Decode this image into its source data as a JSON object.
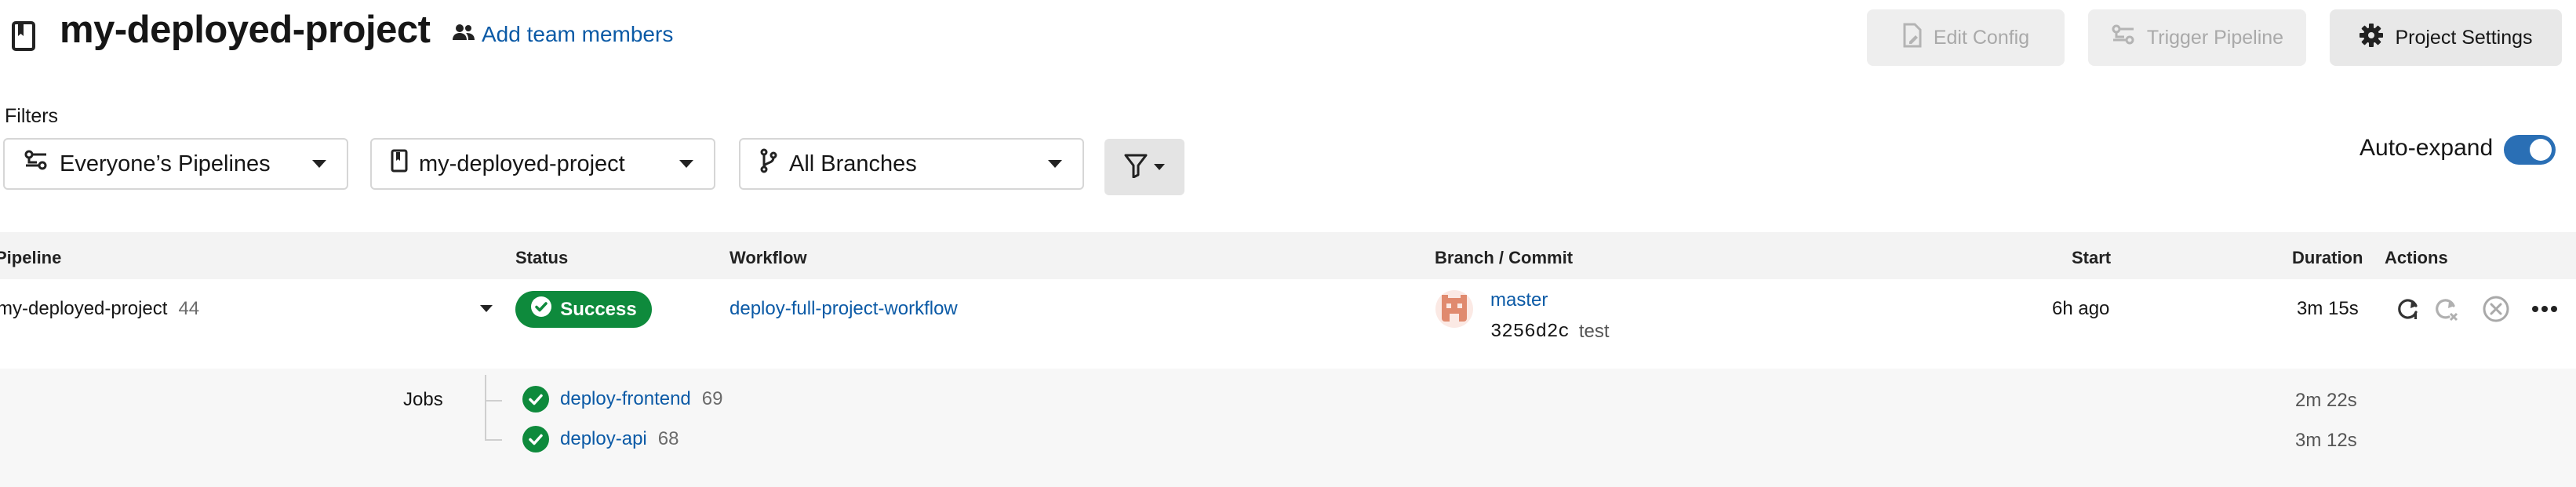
{
  "header": {
    "project_title": "my-deployed-project",
    "add_team_label": "Add team members",
    "edit_config_label": "Edit Config",
    "trigger_pipeline_label": "Trigger Pipeline",
    "project_settings_label": "Project Settings"
  },
  "filters": {
    "label": "Filters",
    "pipelines_dropdown": "Everyone’s Pipelines",
    "project_dropdown": "my-deployed-project",
    "branches_dropdown": "All Branches",
    "auto_expand_label": "Auto-expand",
    "auto_expand_on": true
  },
  "table": {
    "headers": {
      "pipeline": "Pipeline",
      "status": "Status",
      "workflow": "Workflow",
      "branch_commit": "Branch / Commit",
      "start": "Start",
      "duration": "Duration",
      "actions": "Actions"
    },
    "row": {
      "pipeline_name": "my-deployed-project",
      "pipeline_number": "44",
      "status": "Success",
      "workflow": "deploy-full-project-workflow",
      "branch": "master",
      "commit_hash": "3256d2c",
      "commit_message": "test",
      "start": "6h ago",
      "duration": "3m 15s"
    },
    "jobs_label": "Jobs",
    "jobs": [
      {
        "name": "deploy-frontend",
        "number": "69",
        "duration": "2m 22s"
      },
      {
        "name": "deploy-api",
        "number": "68",
        "duration": "3m 12s"
      }
    ]
  },
  "colors": {
    "link": "#0b5aa6",
    "success": "#0e8a3c",
    "toggle": "#2a6fb5"
  }
}
